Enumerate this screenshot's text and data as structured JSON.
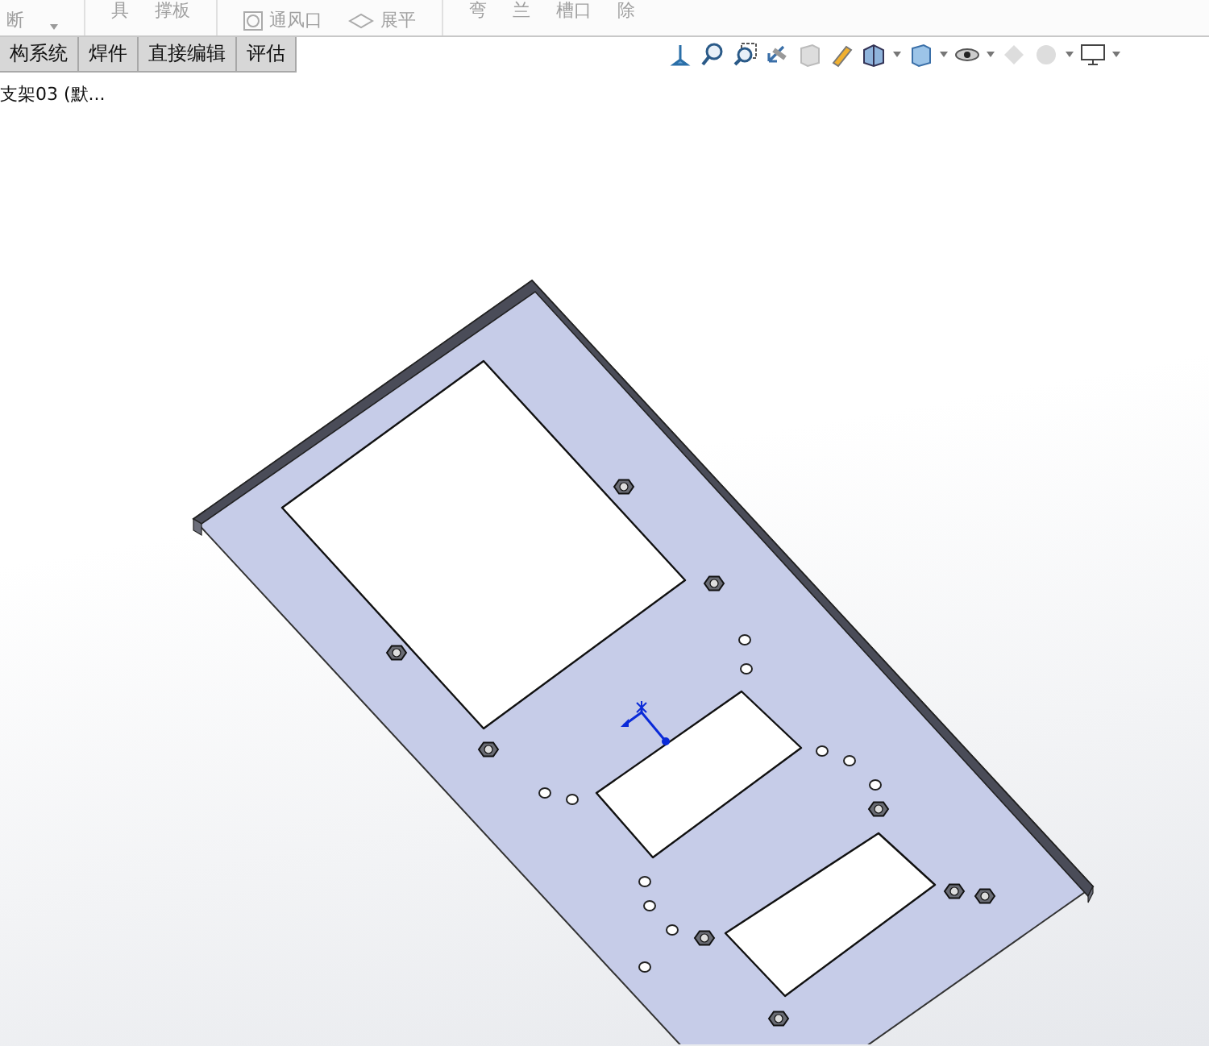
{
  "ribbon": {
    "items": [
      {
        "label": "断",
        "kind": "lower"
      },
      {
        "label": "具",
        "kind": "upper"
      },
      {
        "label": "撑板",
        "kind": "upper"
      },
      {
        "label": "通风口",
        "kind": "vent"
      },
      {
        "label": "展平",
        "kind": "flatten"
      },
      {
        "label": "弯",
        "kind": "upper"
      },
      {
        "label": "兰",
        "kind": "upper"
      },
      {
        "label": "槽口",
        "kind": "upper"
      },
      {
        "label": "除",
        "kind": "upper"
      }
    ]
  },
  "tabs": [
    {
      "label": "构系统",
      "selected": false
    },
    {
      "label": "焊件",
      "selected": false
    },
    {
      "label": "直接编辑",
      "selected": false
    },
    {
      "label": "评估",
      "selected": false
    }
  ],
  "tree": {
    "item": "支架03 (默..."
  }
}
